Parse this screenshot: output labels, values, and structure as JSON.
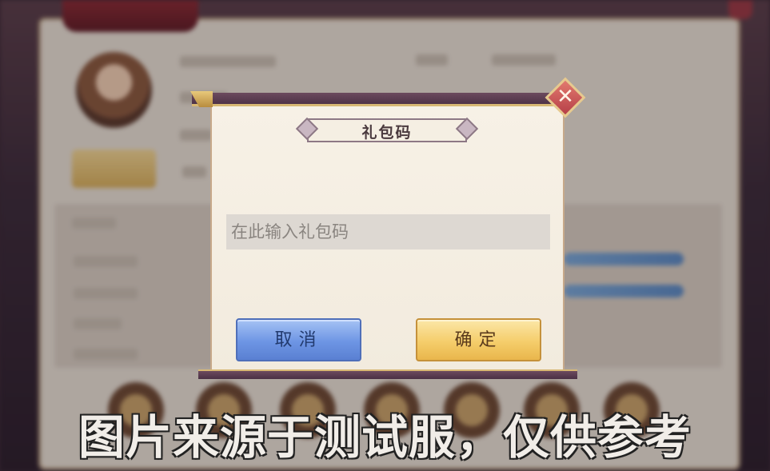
{
  "dialog": {
    "title": "礼包码",
    "input_placeholder": "在此输入礼包码",
    "input_value": "",
    "cancel_label": "取消",
    "confirm_label": "确定",
    "close_icon": "close-icon"
  },
  "watermark": {
    "text": "图片来源于测试服，仅供参考"
  },
  "colors": {
    "cancel_button": "#6d95e4",
    "confirm_button": "#f5cd6b",
    "dialog_frame": "#4a3044",
    "accent_gold": "#d8b873"
  }
}
